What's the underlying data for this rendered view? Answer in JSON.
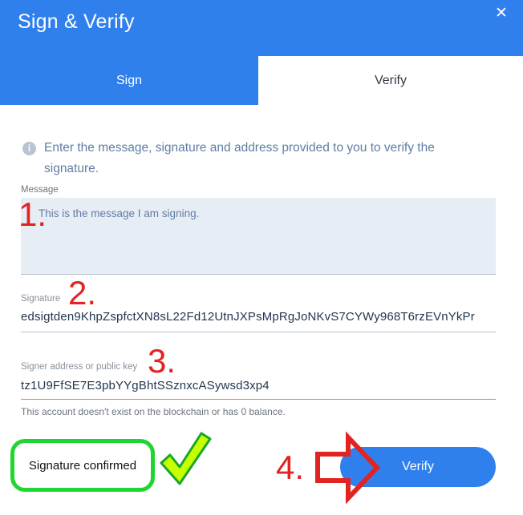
{
  "dialog": {
    "title": "Sign & Verify",
    "close_icon": "close-icon",
    "accent_color": "#2f80ed"
  },
  "tabs": [
    {
      "label": "Sign",
      "active": false
    },
    {
      "label": "Verify",
      "active": true
    }
  ],
  "info": {
    "icon": "info-icon",
    "icon_glyph": "i",
    "text": "Enter the message, signature and address provided to you to verify the signature."
  },
  "message": {
    "label": "Message",
    "value": "This is the message I am signing."
  },
  "signature": {
    "label": "Signature",
    "value": "edsigtden9KhpZspfctXN8sL22Fd12UtnJXPsMpRgJoNKvS7CYWy968T6rzEVnYkPr"
  },
  "signer": {
    "label": "Signer address or public key",
    "value": "tz1U9FfSE7E3pbYYgBhtSSznxcASywsd3xp4",
    "helper": "This account doesn't exist on the blockchain or has 0 balance."
  },
  "result": {
    "text": "Signature confirmed",
    "border_color": "#1fd631"
  },
  "verify_button": {
    "label": "Verify"
  },
  "annotations": {
    "step1": "1.",
    "step2": "2.",
    "step3": "3.",
    "step4": "4.",
    "color": "#e3231f"
  }
}
